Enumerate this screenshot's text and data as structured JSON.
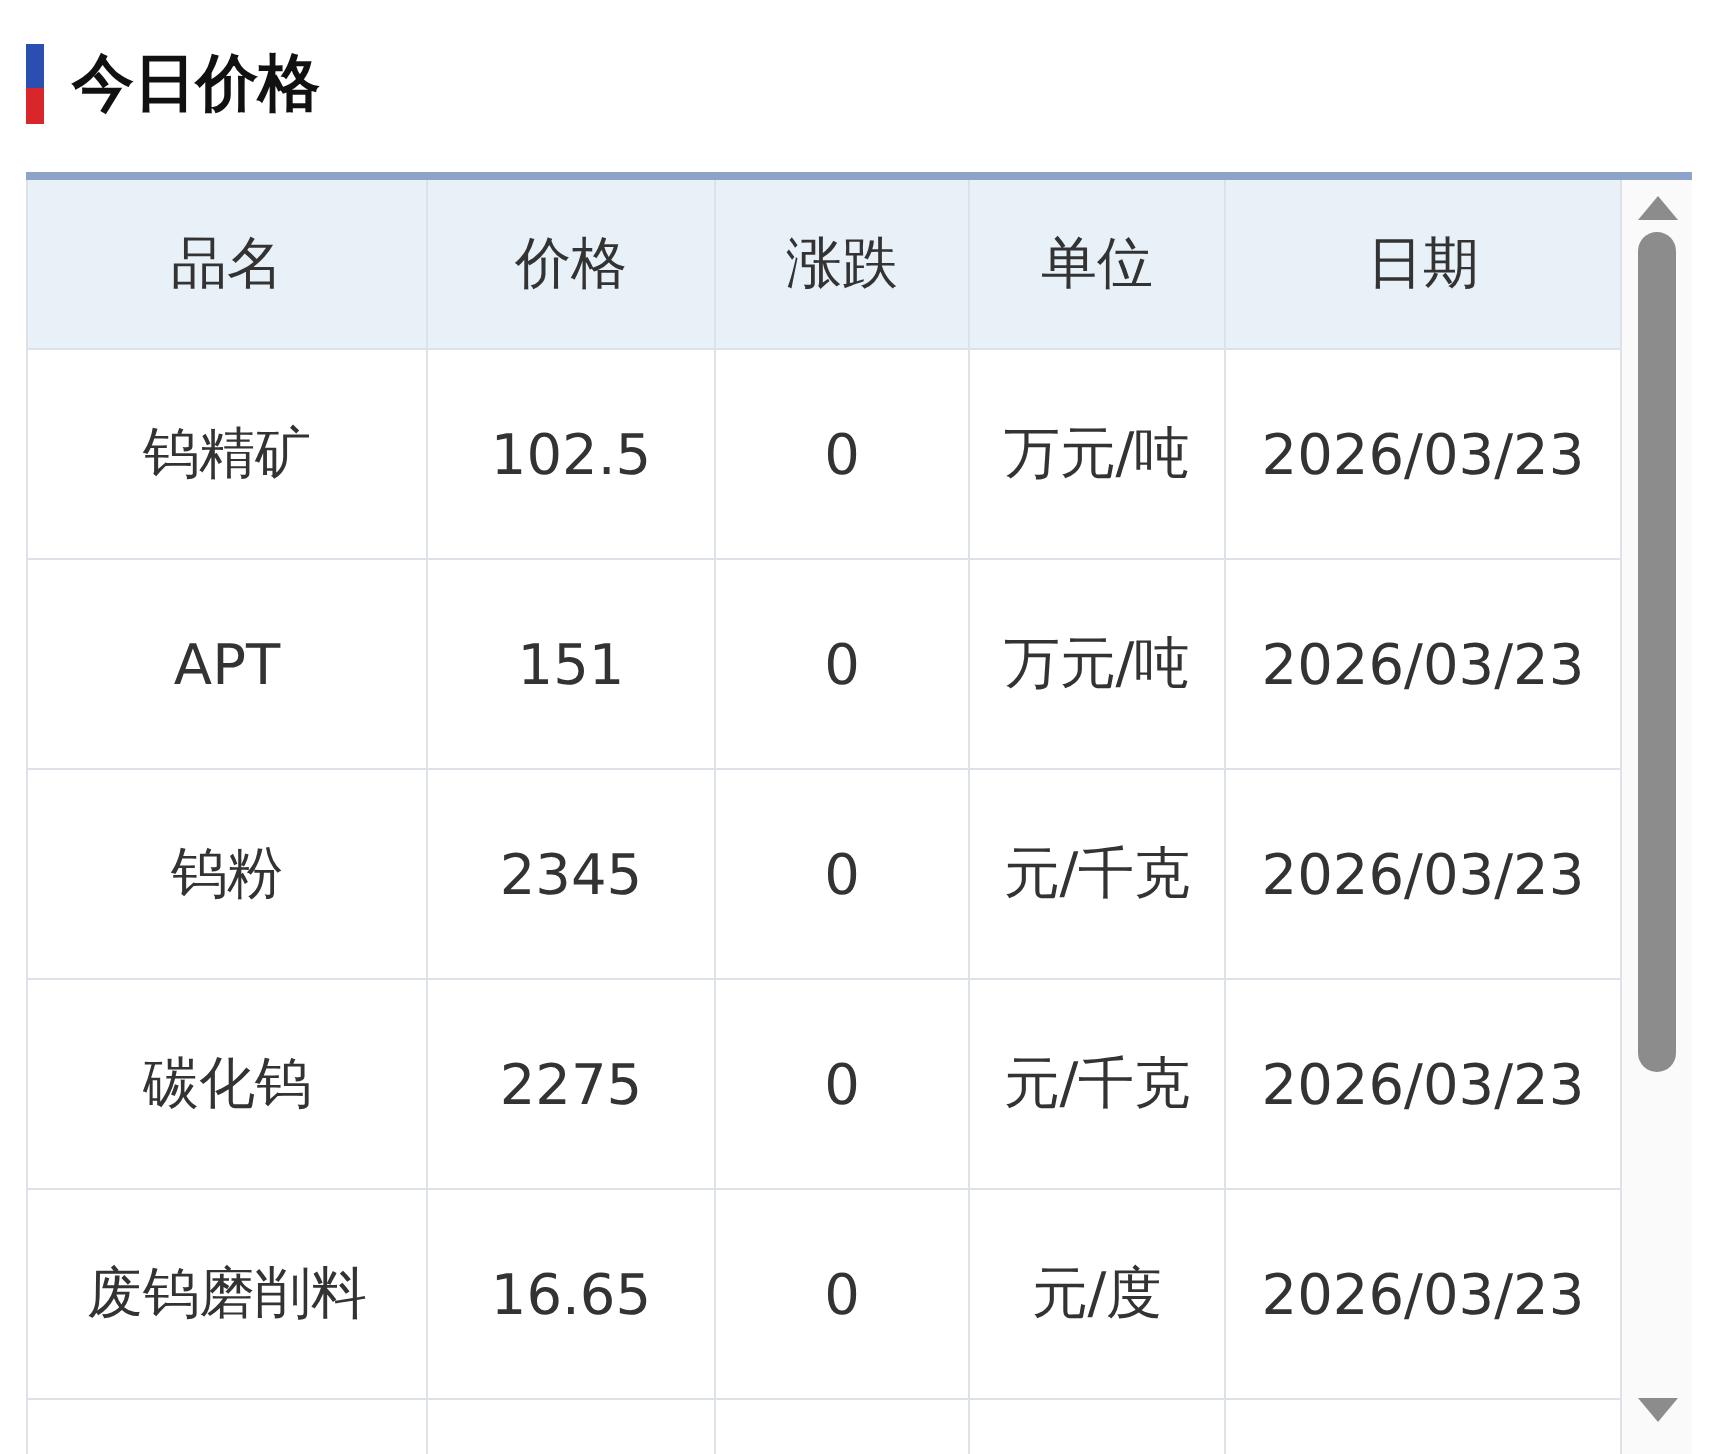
{
  "title": "今日价格",
  "table": {
    "columns": [
      "品名",
      "价格",
      "涨跌",
      "单位",
      "日期"
    ],
    "rows": [
      [
        "钨精矿",
        "102.5",
        "0",
        "万元/吨",
        "2026/03/23"
      ],
      [
        "APT",
        "151",
        "0",
        "万元/吨",
        "2026/03/23"
      ],
      [
        "钨粉",
        "2345",
        "0",
        "元/千克",
        "2026/03/23"
      ],
      [
        "碳化钨",
        "2275",
        "0",
        "元/千克",
        "2026/03/23"
      ],
      [
        "废钨磨削料",
        "16.65",
        "0",
        "元/度",
        "2026/03/23"
      ]
    ]
  }
}
